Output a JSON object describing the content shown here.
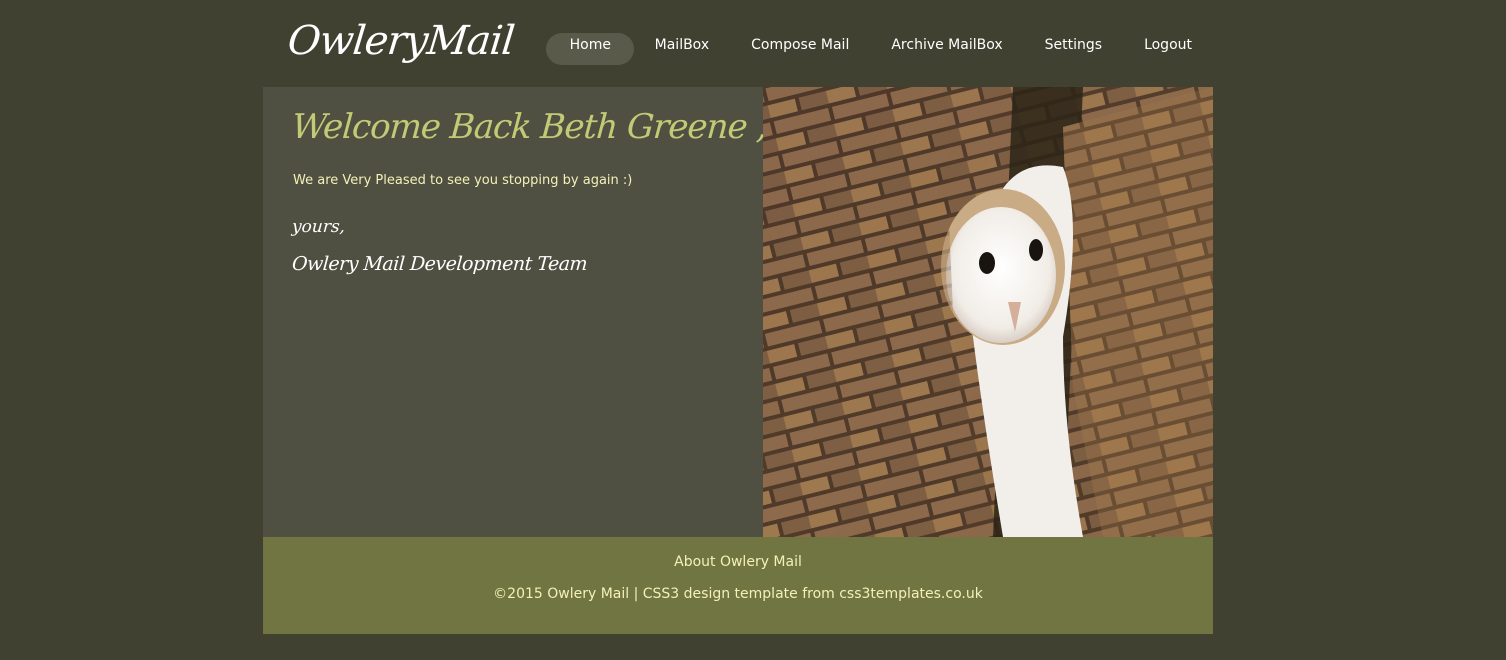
{
  "header": {
    "logo": "OwleryMail"
  },
  "nav": {
    "items": [
      {
        "label": "Home",
        "active": true
      },
      {
        "label": "MailBox"
      },
      {
        "label": "Compose Mail"
      },
      {
        "label": "Archive MailBox"
      },
      {
        "label": "Settings"
      },
      {
        "label": "Logout"
      }
    ]
  },
  "main": {
    "welcome": "Welcome Back Beth Greene ,",
    "message": "We are Very Pleased to see you stopping by again :)",
    "signoff": "yours,",
    "team": "Owlery Mail Development Team"
  },
  "footer": {
    "about": "About Owlery Mail",
    "copyright": "©2015 Owlery Mail | CSS3 design template from css3templates.co.uk"
  },
  "colors": {
    "page_bg": "#414132",
    "content_bg": "#505042",
    "footer_bg": "#707541",
    "welcome_text": "#c1cb75",
    "body_text": "#f4f0b8",
    "nav_active_bg": "#5a5a4b"
  }
}
